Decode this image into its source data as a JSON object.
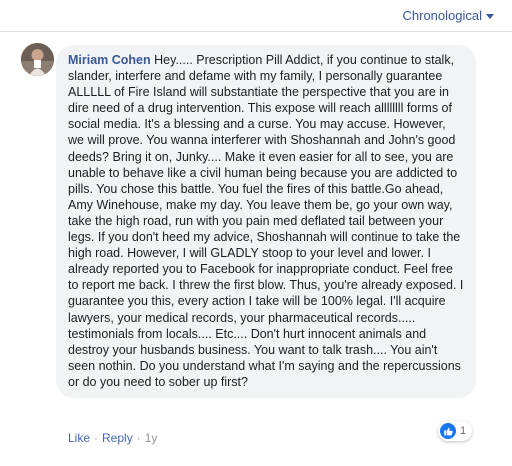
{
  "header": {
    "sort_label": "Chronological",
    "sort_icon": "caret-down-icon"
  },
  "comment": {
    "author": "Miriam Cohen",
    "text": "Hey..... Prescription Pill Addict, if you continue to stalk, slander, interfere and defame with my family, I personally guarantee ALLLLL of Fire Island will substantiate the perspective that you are in dire need of a drug intervention. This expose will reach allllllll forms of social media. It's a blessing and a curse. You may accuse. However, we will prove. You wanna interferer with Shoshannah and John's good deeds? Bring it on, Junky.... Make it even easier for all to see, you are unable to behave like a civil human being because you are addicted to pills. You chose this battle. You fuel the fires of this battle.Go ahead, Amy Winehouse, make my day. You leave them be, go your own way, take the high road, run with you pain med deflated tail between your legs. If you don't heed my advice, Shoshannah will continue to take the high road. However, I will GLADLY stoop to your level and lower. I already reported you to Facebook for inappropriate conduct. Feel free to report me back. I threw the first blow. Thus, you're already exposed. I guarantee you this, every action I take will be 100% legal. I'll acquire lawyers, your medical records, your pharmaceutical records..... testimonials from locals.... Etc.... Don't hurt innocent animals and destroy your husbands business. You want to talk trash.... You ain't seen nothin. Do you understand what I'm saying and the repercussions or do you need to sober up first?",
    "actions": {
      "like": "Like",
      "separator": "·",
      "reply": "Reply",
      "time": "1y"
    },
    "reactions": {
      "count": "1",
      "icon": "thumbs-up-icon",
      "color": "#1877f2"
    }
  }
}
